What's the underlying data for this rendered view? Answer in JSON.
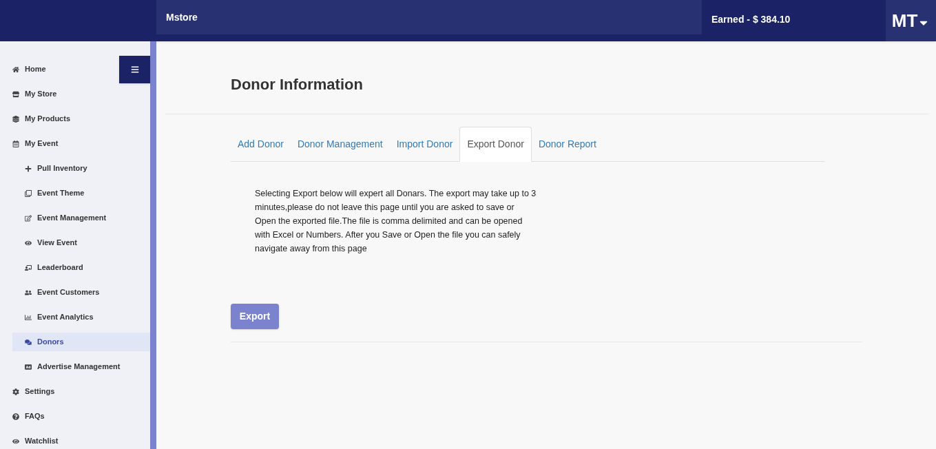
{
  "header": {
    "brand": "Mstore",
    "earned": "Earned - $ 384.10",
    "user": "MT"
  },
  "sidebar": {
    "items": [
      {
        "label": "Home",
        "selected": false
      },
      {
        "label": "My Store",
        "selected": false
      },
      {
        "label": "My Products",
        "selected": false
      },
      {
        "label": "My Event",
        "selected": false,
        "children": [
          {
            "label": "Pull Inventory",
            "selected": false
          },
          {
            "label": "Event Theme",
            "selected": false
          },
          {
            "label": "Event Management",
            "selected": false
          },
          {
            "label": "View Event",
            "selected": false
          },
          {
            "label": "Leaderboard",
            "selected": false
          },
          {
            "label": "Event Customers",
            "selected": false
          },
          {
            "label": "Event Analytics",
            "selected": false
          },
          {
            "label": "Donors",
            "selected": true
          },
          {
            "label": "Advertise Management",
            "selected": false
          }
        ]
      },
      {
        "label": "Settings",
        "selected": false
      },
      {
        "label": "FAQs",
        "selected": false
      },
      {
        "label": "Watchlist",
        "selected": false
      }
    ]
  },
  "page": {
    "title": "Donor Information",
    "tabs": [
      {
        "label": "Add Donor",
        "selected": false
      },
      {
        "label": "Donor Management",
        "selected": false
      },
      {
        "label": "Import Donor",
        "selected": false
      },
      {
        "label": "Export Donor",
        "selected": true
      },
      {
        "label": "Donor Report",
        "selected": false
      }
    ],
    "description": "Selecting Export below will expert all Donars. The export may take up to 3 minutes,please do not leave this page until you are asked to save or Open the exported file.The file is comma delimited and can be opened with Excel or Numbers. After you Save or Open the file you can safely navigate away from this page",
    "button": "Export"
  }
}
